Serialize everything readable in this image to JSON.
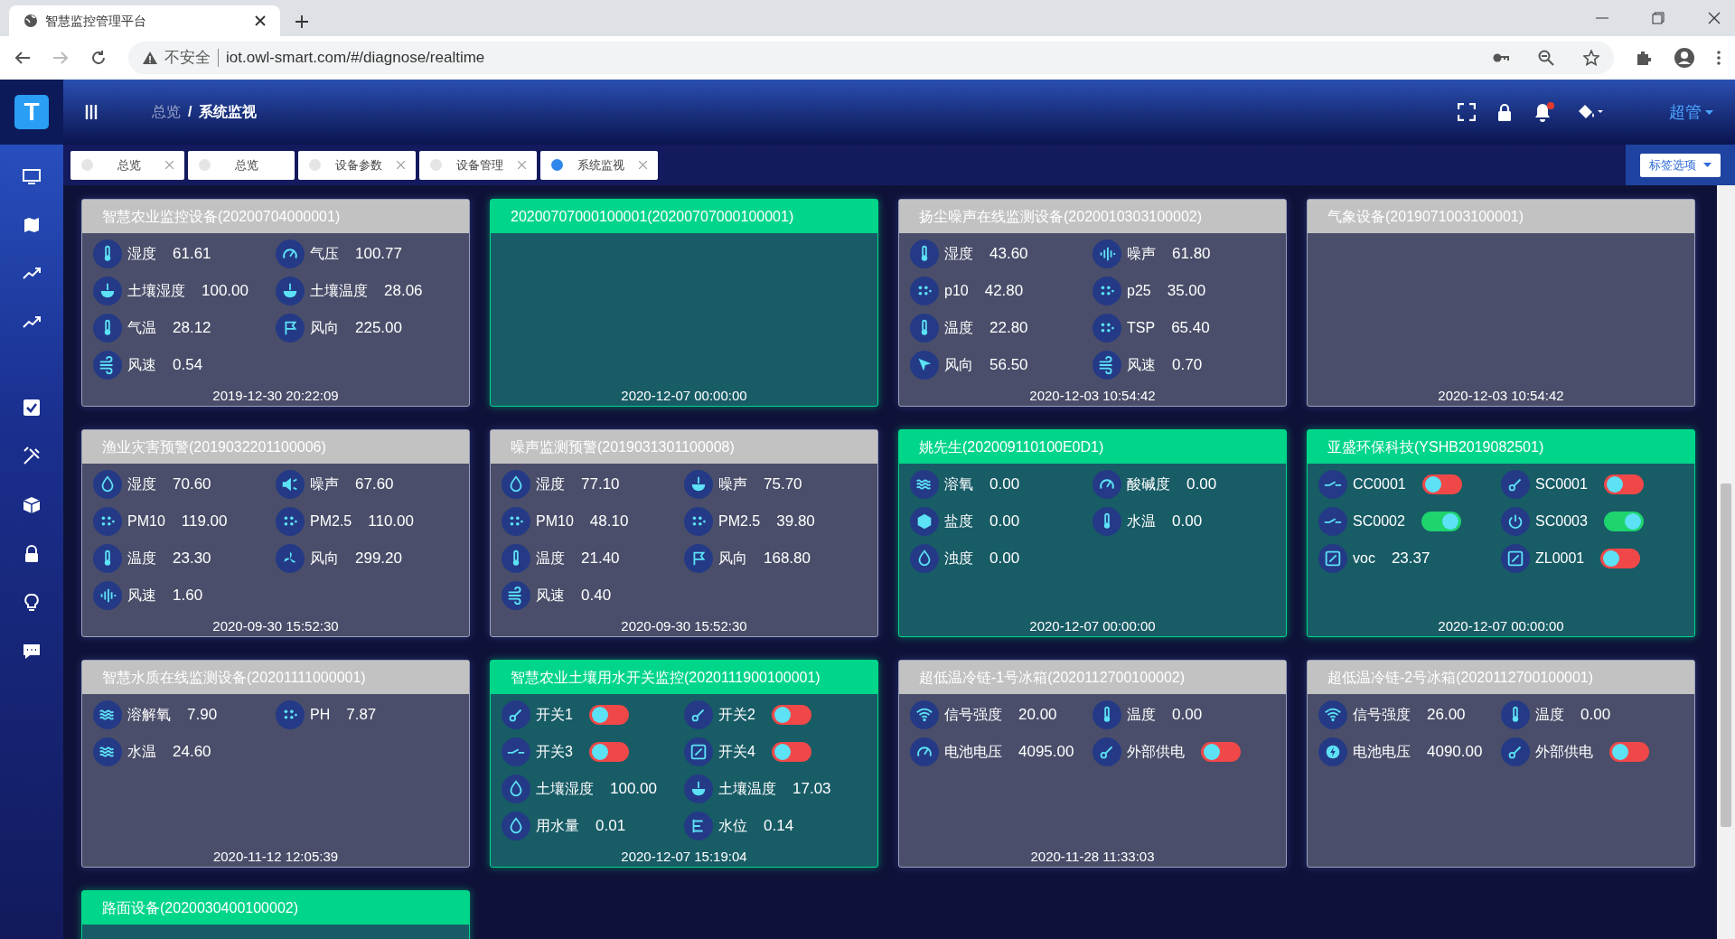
{
  "browser": {
    "tab_title": "智慧监控管理平台",
    "warning": "不安全",
    "url": "iot.owl-smart.com/#/diagnose/realtime"
  },
  "app": {
    "logo": "T",
    "breadcrumb": [
      "总览",
      "系统监视"
    ],
    "breadcrumb_separator": "/",
    "user": "超管"
  },
  "tabs": [
    {
      "label": "总览",
      "selected": false,
      "closable": true
    },
    {
      "label": "总览",
      "selected": false,
      "closable": false
    },
    {
      "label": "设备参数",
      "selected": false,
      "closable": true
    },
    {
      "label": "设备管理",
      "selected": false,
      "closable": true
    },
    {
      "label": "系统监视",
      "selected": true,
      "closable": true
    }
  ],
  "tab_options": "标签选项",
  "devices": [
    {
      "title": "智慧农业监控设备(20200704000001)",
      "online": false,
      "time": "2019-12-30 20:22:09",
      "items": [
        {
          "kind": "value",
          "label": "湿度",
          "value": "61.61"
        },
        {
          "kind": "value",
          "label": "气压",
          "value": "100.77"
        },
        {
          "kind": "value",
          "label": "土壤湿度",
          "value": "100.00"
        },
        {
          "kind": "value",
          "label": "土壤温度",
          "value": "28.06"
        },
        {
          "kind": "value",
          "label": "气温",
          "value": "28.12"
        },
        {
          "kind": "value",
          "label": "风向",
          "value": "225.00"
        },
        {
          "kind": "value",
          "label": "风速",
          "value": "0.54"
        }
      ]
    },
    {
      "title": "20200707000100001(20200707000100001)",
      "online": true,
      "time": "2020-12-07 00:00:00"
    },
    {
      "title": "扬尘噪声在线监测设备(2020010303100002)",
      "online": false,
      "time": "2020-12-03 10:54:42",
      "items": [
        {
          "kind": "value",
          "label": "湿度",
          "value": "43.60"
        },
        {
          "kind": "value",
          "label": "噪声",
          "value": "61.80"
        },
        {
          "kind": "value",
          "label": "p10",
          "value": "42.80"
        },
        {
          "kind": "value",
          "label": "p25",
          "value": "35.00"
        },
        {
          "kind": "value",
          "label": "温度",
          "value": "22.80"
        },
        {
          "kind": "value",
          "label": "TSP",
          "value": "65.40"
        },
        {
          "kind": "value",
          "label": "风向",
          "value": "56.50"
        },
        {
          "kind": "value",
          "label": "风速",
          "value": "0.70"
        }
      ]
    },
    {
      "title": "气象设备(2019071003100001)",
      "online": false,
      "time": "2020-12-03 10:54:42"
    },
    {
      "title": "渔业灾害预警(2019032201100006)",
      "online": false,
      "time": "2020-09-30 15:52:30",
      "items": [
        {
          "kind": "value",
          "label": "湿度",
          "value": "70.60"
        },
        {
          "kind": "value",
          "label": "噪声",
          "value": "67.60"
        },
        {
          "kind": "value",
          "label": "PM10",
          "value": "119.00"
        },
        {
          "kind": "value",
          "label": "PM2.5",
          "value": "110.00"
        },
        {
          "kind": "value",
          "label": "温度",
          "value": "23.30"
        },
        {
          "kind": "value",
          "label": "风向",
          "value": "299.20"
        },
        {
          "kind": "value",
          "label": "风速",
          "value": "1.60"
        }
      ]
    },
    {
      "title": "噪声监测预警(2019031301100008)",
      "online": false,
      "time": "2020-09-30 15:52:30",
      "items": [
        {
          "kind": "value",
          "label": "湿度",
          "value": "77.10"
        },
        {
          "kind": "value",
          "label": "噪声",
          "value": "75.70"
        },
        {
          "kind": "value",
          "label": "PM10",
          "value": "48.10"
        },
        {
          "kind": "value",
          "label": "PM2.5",
          "value": "39.80"
        },
        {
          "kind": "value",
          "label": "温度",
          "value": "21.40"
        },
        {
          "kind": "value",
          "label": "风向",
          "value": "168.80"
        },
        {
          "kind": "value",
          "label": "风速",
          "value": "0.40"
        }
      ]
    },
    {
      "title": "姚先生(202009110100E0D1)",
      "online": true,
      "time": "2020-12-07 00:00:00",
      "items": [
        {
          "kind": "value",
          "label": "溶氧",
          "value": "0.00"
        },
        {
          "kind": "value",
          "label": "酸碱度",
          "value": "0.00"
        },
        {
          "kind": "value",
          "label": "盐度",
          "value": "0.00"
        },
        {
          "kind": "value",
          "label": "水温",
          "value": "0.00"
        },
        {
          "kind": "value",
          "label": "浊度",
          "value": "0.00"
        }
      ]
    },
    {
      "title": "亚盛环保科技(YSHB2019082501)",
      "online": true,
      "time": "2020-12-07 00:00:00",
      "items": [
        {
          "kind": "switch",
          "label": "CC0001",
          "on": false
        },
        {
          "kind": "switch",
          "label": "SC0001",
          "on": false
        },
        {
          "kind": "switch",
          "label": "SC0002",
          "on": true
        },
        {
          "kind": "switch",
          "label": "SC0003",
          "on": true
        },
        {
          "kind": "value",
          "label": "voc",
          "value": "23.37"
        },
        {
          "kind": "switch",
          "label": "ZL0001",
          "on": false
        }
      ]
    },
    {
      "title": "智慧水质在线监测设备(20201111000001)",
      "online": false,
      "time": "2020-11-12 12:05:39",
      "items": [
        {
          "kind": "value",
          "label": "溶解氧",
          "value": "7.90"
        },
        {
          "kind": "value",
          "label": "PH",
          "value": "7.87"
        },
        {
          "kind": "value",
          "label": "水温",
          "value": "24.60"
        }
      ]
    },
    {
      "title": "智慧农业土壤用水开关监控(2020111900100001)",
      "online": true,
      "time": "2020-12-07 15:19:04",
      "items": [
        {
          "kind": "switch",
          "label": "开关1",
          "on": false
        },
        {
          "kind": "switch",
          "label": "开关2",
          "on": false
        },
        {
          "kind": "switch",
          "label": "开关3",
          "on": false
        },
        {
          "kind": "switch",
          "label": "开关4",
          "on": false
        },
        {
          "kind": "value",
          "label": "土壤湿度",
          "value": "100.00"
        },
        {
          "kind": "value",
          "label": "土壤温度",
          "value": "17.03"
        },
        {
          "kind": "value",
          "label": "用水量",
          "value": "0.01"
        },
        {
          "kind": "value",
          "label": "水位",
          "value": "0.14"
        }
      ]
    },
    {
      "title": "超低温冷链-1号冰箱(2020112700100002)",
      "online": false,
      "time": "2020-11-28 11:33:03",
      "items": [
        {
          "kind": "value",
          "label": "信号强度",
          "value": "20.00"
        },
        {
          "kind": "value",
          "label": "温度",
          "value": "0.00"
        },
        {
          "kind": "value",
          "label": "电池电压",
          "value": "4095.00"
        },
        {
          "kind": "switch",
          "label": "外部供电",
          "on": false
        }
      ]
    },
    {
      "title": "超低温冷链-2号冰箱(2020112700100001)",
      "online": false,
      "items": [
        {
          "kind": "value",
          "label": "信号强度",
          "value": "26.00"
        },
        {
          "kind": "value",
          "label": "温度",
          "value": "0.00"
        },
        {
          "kind": "value",
          "label": "电池电压",
          "value": "4090.00"
        },
        {
          "kind": "switch",
          "label": "外部供电",
          "on": false
        }
      ]
    },
    {
      "title": "路面设备(2020030400100002)",
      "online": true
    }
  ]
}
